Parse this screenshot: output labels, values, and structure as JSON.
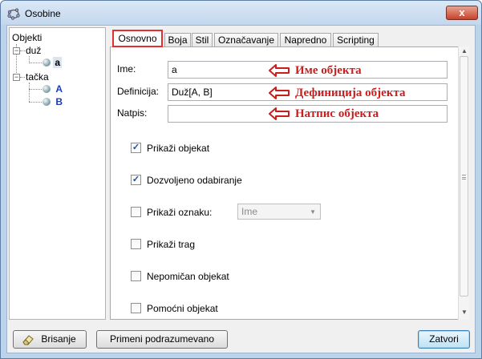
{
  "window": {
    "title": "Osobine",
    "close_label": "x"
  },
  "tree": {
    "root": "Objekti",
    "groups": [
      {
        "label": "duž",
        "children": [
          "a"
        ]
      },
      {
        "label": "tačka",
        "children": [
          "A",
          "B"
        ]
      }
    ]
  },
  "tabs": [
    "Osnovno",
    "Boja",
    "Stil",
    "Označavanje",
    "Napredno",
    "Scripting"
  ],
  "basic": {
    "name_label": "Ime:",
    "name_value": "a",
    "definition_label": "Definicija:",
    "definition_value": "Duž[A, B]",
    "caption_label": "Natpis:",
    "caption_value": ""
  },
  "annotations": {
    "name": "Име објекта",
    "definition": "Дефиниција објекта",
    "caption": "Натпис објекта",
    "color": "#cc1d1d"
  },
  "checkboxes": [
    {
      "label": "Prikaži objekat",
      "checked": true
    },
    {
      "label": "Dozvoljeno odabiranje",
      "checked": true
    },
    {
      "label": "Prikaži oznaku:",
      "checked": false,
      "select": "Ime"
    },
    {
      "label": "Prikaži trag",
      "checked": false
    },
    {
      "label": "Nepomičan objekat",
      "checked": false
    },
    {
      "label": "Pomoćni objekat",
      "checked": false
    }
  ],
  "footer": {
    "delete_label": "Brisanje",
    "defaults_label": "Primeni podrazumevano",
    "close_label": "Zatvori"
  },
  "icons": {
    "app": "geogebra-icon",
    "eraser": "eraser-icon",
    "point": "ball-icon"
  }
}
